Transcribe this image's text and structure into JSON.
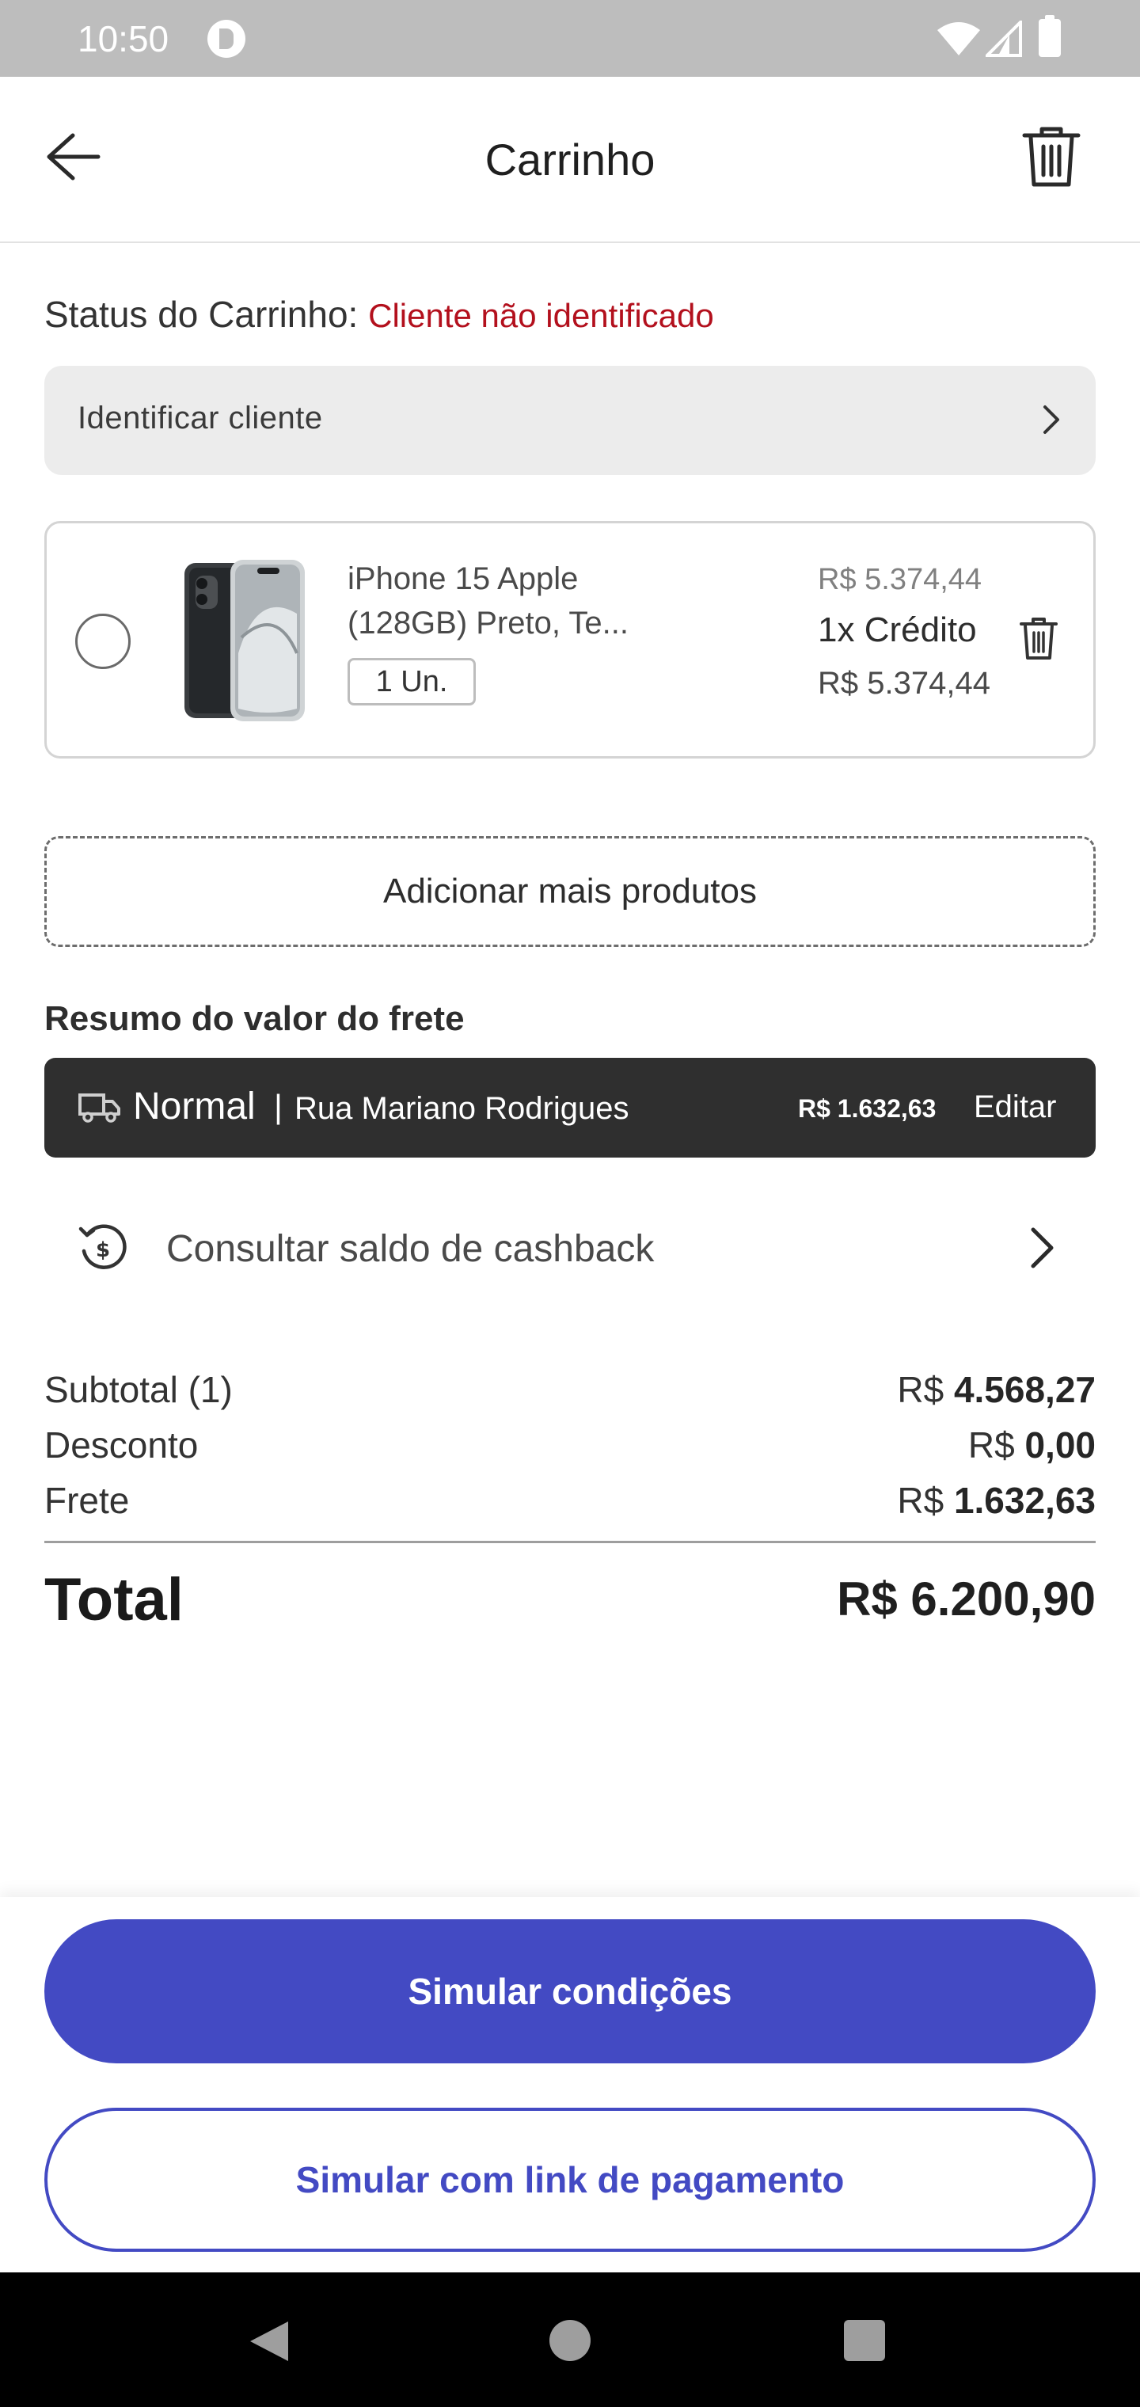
{
  "status_bar": {
    "time": "10:50"
  },
  "header": {
    "title": "Carrinho"
  },
  "cart_status": {
    "label": "Status do Carrinho:",
    "value": "Cliente não identificado"
  },
  "identify_client": {
    "label": "Identificar cliente"
  },
  "product": {
    "name": "iPhone 15 Apple (128GB) Preto, Te...",
    "quantity": "1 Un.",
    "price_original": "R$ 5.374,44",
    "installments": "1x Crédito",
    "price": "R$ 5.374,44"
  },
  "add_more": {
    "label": "Adicionar mais produtos"
  },
  "freight": {
    "title": "Resumo do valor do frete",
    "mode": "Normal",
    "separator": "|",
    "address": "Rua Mariano Rodrigues",
    "value": "R$ 1.632,63",
    "edit_label": "Editar"
  },
  "cashback": {
    "label": "Consultar saldo de cashback"
  },
  "summary": {
    "subtotal_label": "Subtotal (1)",
    "subtotal_currency": "R$",
    "subtotal_value": "4.568,27",
    "discount_label": "Desconto",
    "discount_currency": "R$",
    "discount_value": "0,00",
    "freight_label": "Frete",
    "freight_currency": "R$",
    "freight_value": "1.632,63",
    "total_label": "Total",
    "total_value": "R$ 6.200,90"
  },
  "actions": {
    "simulate_label": "Simular condições",
    "simulate_link_label": "Simular com link de pagamento"
  },
  "colors": {
    "accent": "#434ac3",
    "status_error": "#b3101d",
    "freight_bar": "#2f2f2f"
  }
}
